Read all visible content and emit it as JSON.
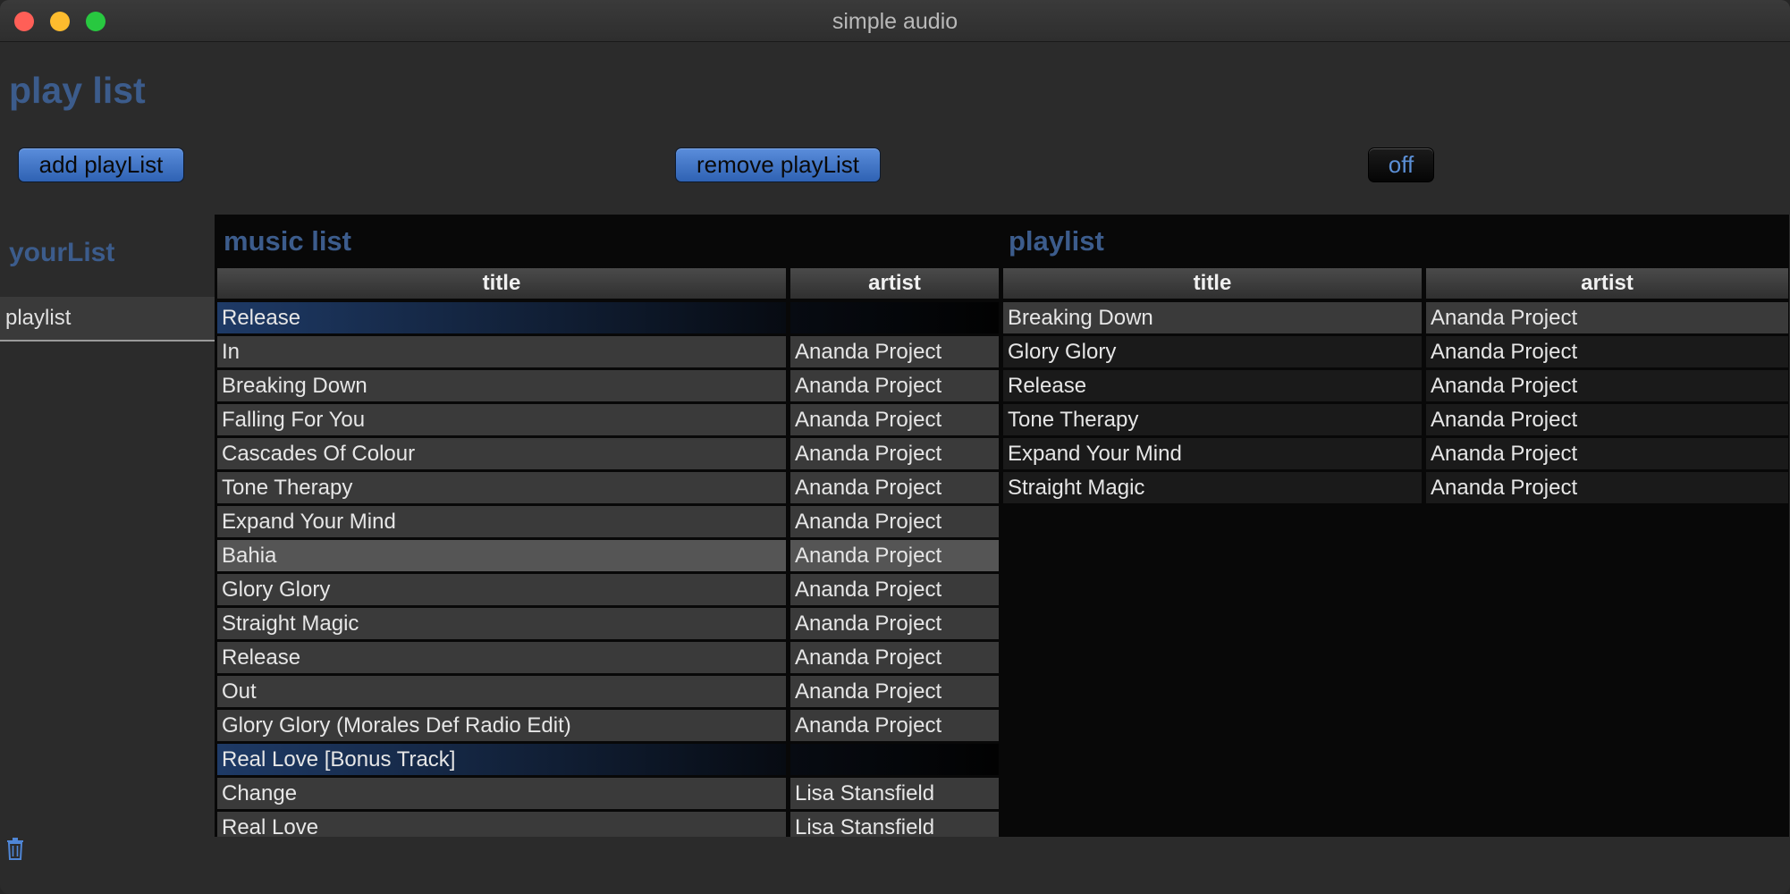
{
  "window": {
    "title": "simple audio"
  },
  "page": {
    "heading": "play list"
  },
  "toolbar": {
    "add_label": "add playList",
    "remove_label": "remove playList",
    "toggle_label": "off"
  },
  "sidebar": {
    "title": "yourList",
    "items": [
      {
        "label": "playlist"
      }
    ]
  },
  "music_list": {
    "title": "music list",
    "headers": {
      "title": "title",
      "artist": "artist"
    },
    "rows": [
      {
        "title": "Release",
        "artist": ""
      },
      {
        "title": "In",
        "artist": "Ananda Project"
      },
      {
        "title": "Breaking Down",
        "artist": "Ananda Project"
      },
      {
        "title": "Falling For You",
        "artist": "Ananda Project"
      },
      {
        "title": "Cascades Of Colour",
        "artist": "Ananda Project"
      },
      {
        "title": "Tone Therapy",
        "artist": "Ananda Project"
      },
      {
        "title": "Expand Your Mind",
        "artist": "Ananda Project"
      },
      {
        "title": "Bahia",
        "artist": "Ananda Project"
      },
      {
        "title": "Glory Glory",
        "artist": "Ananda Project"
      },
      {
        "title": "Straight Magic",
        "artist": "Ananda Project"
      },
      {
        "title": "Release",
        "artist": "Ananda Project"
      },
      {
        "title": "Out",
        "artist": "Ananda Project"
      },
      {
        "title": "Glory Glory (Morales Def Radio Edit)",
        "artist": "Ananda Project"
      },
      {
        "title": "Real Love [Bonus Track]",
        "artist": ""
      },
      {
        "title": "Change",
        "artist": "Lisa Stansfield"
      },
      {
        "title": "Real Love",
        "artist": "Lisa Stansfield"
      }
    ]
  },
  "playlist": {
    "title": "playlist",
    "headers": {
      "title": "title",
      "artist": "artist"
    },
    "rows": [
      {
        "title": "Breaking Down",
        "artist": "Ananda Project"
      },
      {
        "title": "Glory Glory",
        "artist": "Ananda Project"
      },
      {
        "title": "Release",
        "artist": "Ananda Project"
      },
      {
        "title": "Tone Therapy",
        "artist": "Ananda Project"
      },
      {
        "title": "Expand Your Mind",
        "artist": "Ananda Project"
      },
      {
        "title": "Straight Magic",
        "artist": "Ananda Project"
      }
    ]
  },
  "icons": {
    "trash": "trash-icon"
  },
  "colors": {
    "accent": "#3c5c8c",
    "button": "#4a7fd0",
    "background": "#2b2b2b"
  }
}
